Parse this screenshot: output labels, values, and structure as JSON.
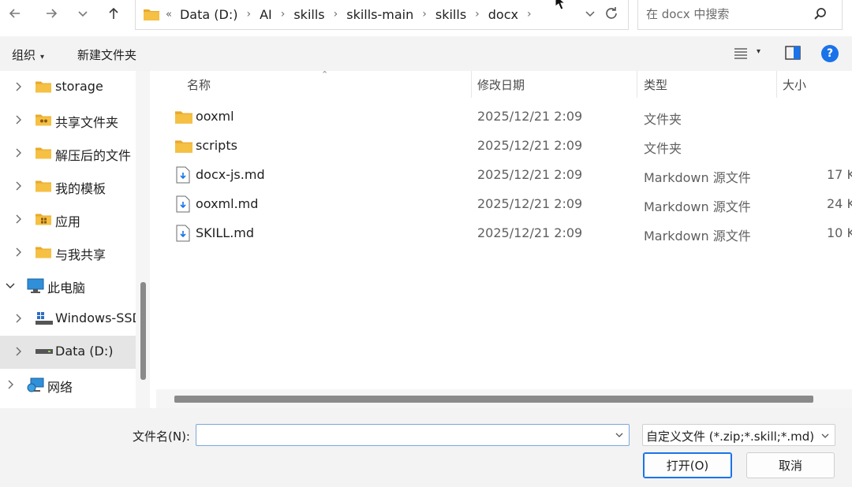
{
  "nav": {
    "back_icon": "arrow-left-icon",
    "forward_icon": "arrow-right-icon",
    "recent_icon": "chevron-down-icon",
    "up_icon": "arrow-up-icon"
  },
  "address": {
    "overflow": "«",
    "crumbs": [
      "Data (D:)",
      "AI",
      "skills",
      "skills-main",
      "skills",
      "docx"
    ]
  },
  "search": {
    "placeholder": "在 docx 中搜索"
  },
  "toolbar": {
    "organize": "组织",
    "new_folder": "新建文件夹"
  },
  "sidebar": {
    "items": [
      {
        "label": "storage"
      },
      {
        "label": "共享文件夹"
      },
      {
        "label": "解压后的文件"
      },
      {
        "label": "我的模板"
      },
      {
        "label": "应用"
      },
      {
        "label": "与我共享"
      },
      {
        "label": "此电脑"
      },
      {
        "label": "Windows-SSD"
      },
      {
        "label": "Data (D:)"
      },
      {
        "label": "网络"
      }
    ]
  },
  "columns": {
    "name": "名称",
    "date": "修改日期",
    "type": "类型",
    "size": "大小"
  },
  "files": [
    {
      "name": "ooxml",
      "date": "2025/12/21 2:09",
      "type": "文件夹",
      "size": ""
    },
    {
      "name": "scripts",
      "date": "2025/12/21 2:09",
      "type": "文件夹",
      "size": ""
    },
    {
      "name": "docx-js.md",
      "date": "2025/12/21 2:09",
      "type": "Markdown 源文件",
      "size": "17 K"
    },
    {
      "name": "ooxml.md",
      "date": "2025/12/21 2:09",
      "type": "Markdown 源文件",
      "size": "24 K"
    },
    {
      "name": "SKILL.md",
      "date": "2025/12/21 2:09",
      "type": "Markdown 源文件",
      "size": "10 K"
    }
  ],
  "footer": {
    "filename_label": "文件名(N):",
    "filename_value": "",
    "filter": "自定义文件 (*.zip;*.skill;*.md)",
    "open_label": "打开(O)",
    "cancel_label": "取消"
  },
  "colors": {
    "accent": "#1a73e8",
    "folder": "#f5c043",
    "selected": "#e5e5e5"
  }
}
